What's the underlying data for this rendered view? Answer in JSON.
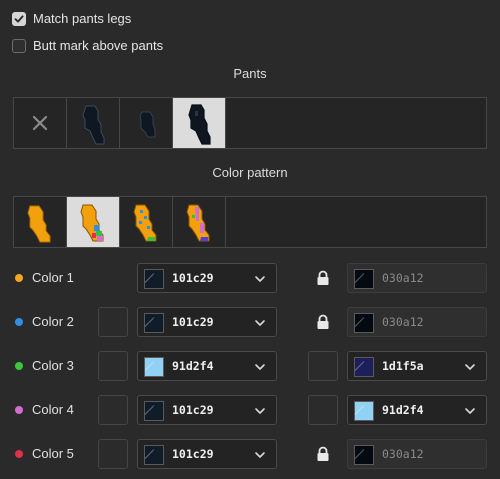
{
  "options": {
    "match_pants_legs": {
      "label": "Match pants legs",
      "checked": true
    },
    "butt_mark_above_pants": {
      "label": "Butt mark above pants",
      "checked": false
    }
  },
  "pants": {
    "title": "Pants",
    "tiles": [
      {
        "name": "none",
        "selected": false
      },
      {
        "name": "pants-style-1",
        "selected": false
      },
      {
        "name": "pants-style-2",
        "selected": false
      },
      {
        "name": "pants-style-3",
        "selected": true
      }
    ]
  },
  "color_pattern": {
    "title": "Color pattern",
    "tiles": [
      {
        "name": "pattern-1",
        "selected": false
      },
      {
        "name": "pattern-2",
        "selected": true
      },
      {
        "name": "pattern-3",
        "selected": false
      },
      {
        "name": "pattern-4",
        "selected": false
      }
    ]
  },
  "colors": [
    {
      "label": "Color 1",
      "dot": "#f5a623",
      "link_box": "none",
      "value": "101c29",
      "swatch": "#101c29",
      "right_box": "lock",
      "right_value": "030a12",
      "right_swatch": "#030a12",
      "right_enabled": false
    },
    {
      "label": "Color 2",
      "dot": "#2f8fe8",
      "link_box": "empty",
      "value": "101c29",
      "swatch": "#101c29",
      "right_box": "lock",
      "right_value": "030a12",
      "right_swatch": "#030a12",
      "right_enabled": false
    },
    {
      "label": "Color 3",
      "dot": "#3cc83c",
      "link_box": "empty",
      "value": "91d2f4",
      "swatch": "#91d2f4",
      "right_box": "empty",
      "right_value": "1d1f5a",
      "right_swatch": "#1d1f5a",
      "right_enabled": true
    },
    {
      "label": "Color 4",
      "dot": "#d26cd2",
      "link_box": "empty",
      "value": "101c29",
      "swatch": "#101c29",
      "right_box": "empty",
      "right_value": "91d2f4",
      "right_swatch": "#91d2f4",
      "right_enabled": true
    },
    {
      "label": "Color 5",
      "dot": "#e0304a",
      "link_box": "empty",
      "value": "101c29",
      "swatch": "#101c29",
      "right_box": "lock",
      "right_value": "030a12",
      "right_swatch": "#030a12",
      "right_enabled": false
    }
  ]
}
